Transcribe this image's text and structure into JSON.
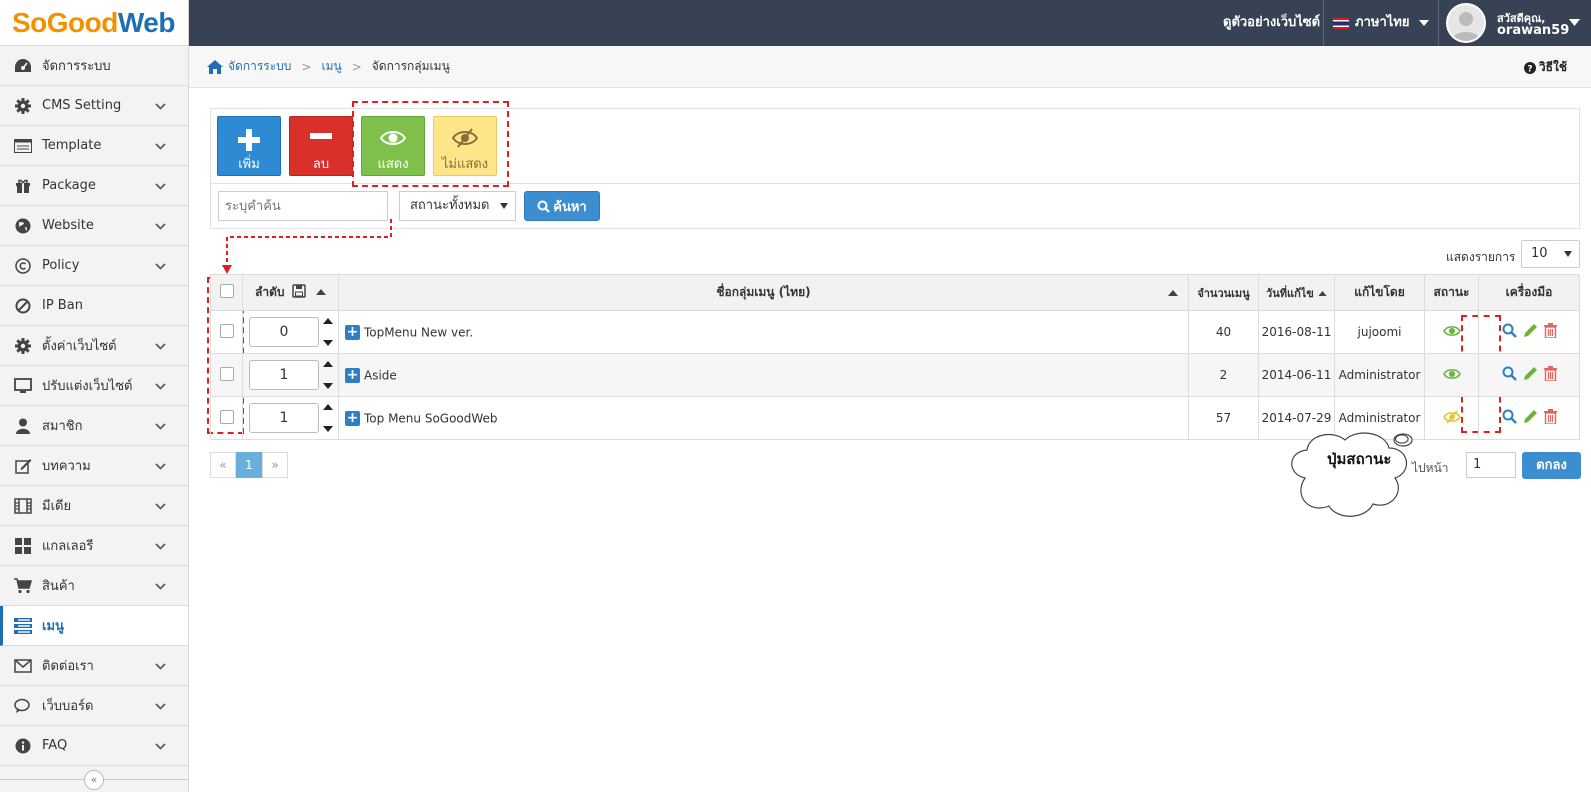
{
  "logo": {
    "part1": "SoGood",
    "part2": "Web"
  },
  "sidebar": {
    "items": [
      {
        "label": "จัดการระบบ",
        "icon": "dashboard-icon",
        "chevron": false
      },
      {
        "label": "CMS Setting",
        "icon": "gear-icon",
        "chevron": true
      },
      {
        "label": "Template",
        "icon": "list-icon",
        "chevron": true
      },
      {
        "label": "Package",
        "icon": "gift-icon",
        "chevron": true
      },
      {
        "label": "Website",
        "icon": "globe-icon",
        "chevron": true
      },
      {
        "label": "Policy",
        "icon": "copyright-icon",
        "chevron": true
      },
      {
        "label": "IP Ban",
        "icon": "ban-icon",
        "chevron": false
      },
      {
        "label": "ตั้งค่าเว็บไซต์",
        "icon": "gear-icon",
        "chevron": true
      },
      {
        "label": "ปรับแต่งเว็บไซต์",
        "icon": "monitor-icon",
        "chevron": true
      },
      {
        "label": "สมาชิก",
        "icon": "user-icon",
        "chevron": true
      },
      {
        "label": "บทความ",
        "icon": "edit-icon",
        "chevron": true
      },
      {
        "label": "มีเดีย",
        "icon": "film-icon",
        "chevron": true
      },
      {
        "label": "แกลเลอรี",
        "icon": "grid-icon",
        "chevron": true
      },
      {
        "label": "สินค้า",
        "icon": "cart-icon",
        "chevron": true
      },
      {
        "label": "เมนู",
        "icon": "menu-icon",
        "chevron": false,
        "active": true
      },
      {
        "label": "ติดต่อเรา",
        "icon": "envelope-icon",
        "chevron": true
      },
      {
        "label": "เว็บบอร์ด",
        "icon": "comments-icon",
        "chevron": true
      },
      {
        "label": "FAQ",
        "icon": "info-icon",
        "chevron": true
      }
    ],
    "collapse_label": "«"
  },
  "topbar": {
    "preview_label": "ดูตัวอย่างเว็บไซต์",
    "language_label": "ภาษาไทย",
    "greeting": "สวัสดีคุณ,",
    "username": "orawan59"
  },
  "breadcrumb": {
    "home": "จัดการระบบ",
    "level2": "เมนู",
    "current": "จัดการกลุ่มเมนู"
  },
  "help_label": "วิธีใช้",
  "toolbar": {
    "add_label": "เพิ่ม",
    "delete_label": "ลบ",
    "show_label": "แสดง",
    "hide_label": "ไม่แสดง"
  },
  "search": {
    "placeholder": "ระบุคำค้น",
    "status_selected": "สถานะทั้งหมด",
    "button_label": "ค้นหา"
  },
  "pagesize": {
    "label": "แสดงรายการ",
    "value": "10"
  },
  "table": {
    "headers": {
      "order": "ลำดับ",
      "name": "ชื่อกลุ่มเมนู (ไทย)",
      "count": "จำนวนเมนู",
      "date": "วันที่แก้ไข",
      "by": "แก้ไขโดย",
      "status": "สถานะ",
      "tools": "เครื่องมือ"
    },
    "rows": [
      {
        "order": "0",
        "name": "TopMenu New ver.",
        "count": "40",
        "date": "2016-08-11",
        "by": "jujoomi",
        "status": "show"
      },
      {
        "order": "1",
        "name": "Aside",
        "count": "2",
        "date": "2014-06-11",
        "by": "Administrator",
        "status": "show"
      },
      {
        "order": "1",
        "name": "Top Menu SoGoodWeb",
        "count": "57",
        "date": "2014-07-29",
        "by": "Administrator",
        "status": "hide"
      }
    ]
  },
  "pagination": {
    "prev": "«",
    "current": "1",
    "next": "»"
  },
  "goto": {
    "label": "ไปหน้า",
    "value": "1",
    "button_label": "ตกลง"
  },
  "annotation": {
    "callout_text": "ปุ่มสถานะ"
  },
  "colors": {
    "topbar": "#374355",
    "brand_blue": "#1f6fb5",
    "brand_orange": "#f39200",
    "add": "#2d8ad3",
    "delete": "#d9302b",
    "show": "#7fbf4c",
    "hide": "#fde58a",
    "annotation": "#e02020"
  }
}
